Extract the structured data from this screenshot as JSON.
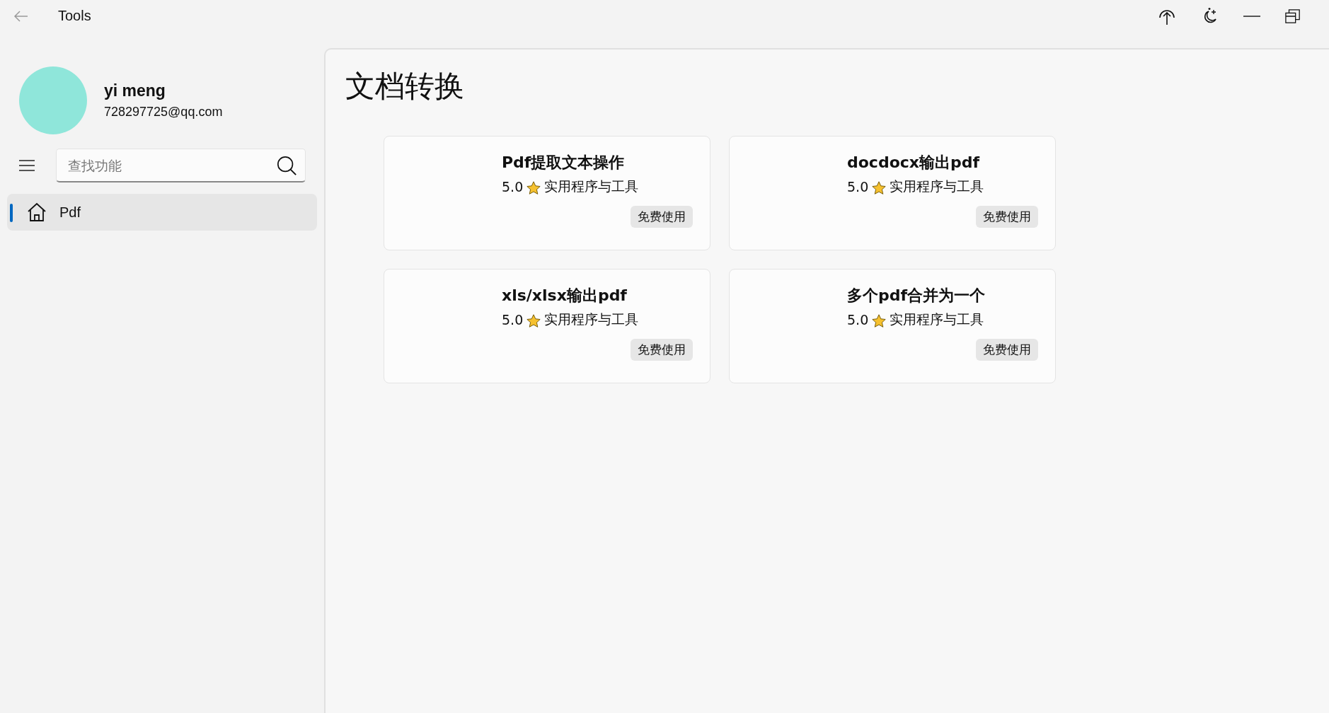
{
  "window": {
    "title": "Tools"
  },
  "user": {
    "name": "yi meng",
    "email": "728297725@qq.com"
  },
  "search": {
    "placeholder": "查找功能"
  },
  "nav": [
    {
      "label": "Pdf",
      "selected": true
    }
  ],
  "page": {
    "heading": "文档转换"
  },
  "cards": [
    {
      "title": "Pdf提取文本操作",
      "rating": "5.0",
      "category": "实用程序与工具",
      "action": "免费使用"
    },
    {
      "title": "docdocx输出pdf",
      "rating": "5.0",
      "category": "实用程序与工具",
      "action": "免费使用"
    },
    {
      "title": "xls/xlsx输出pdf",
      "rating": "5.0",
      "category": "实用程序与工具",
      "action": "免费使用"
    },
    {
      "title": "多个pdf合并为一个",
      "rating": "5.0",
      "category": "实用程序与工具",
      "action": "免费使用"
    }
  ]
}
